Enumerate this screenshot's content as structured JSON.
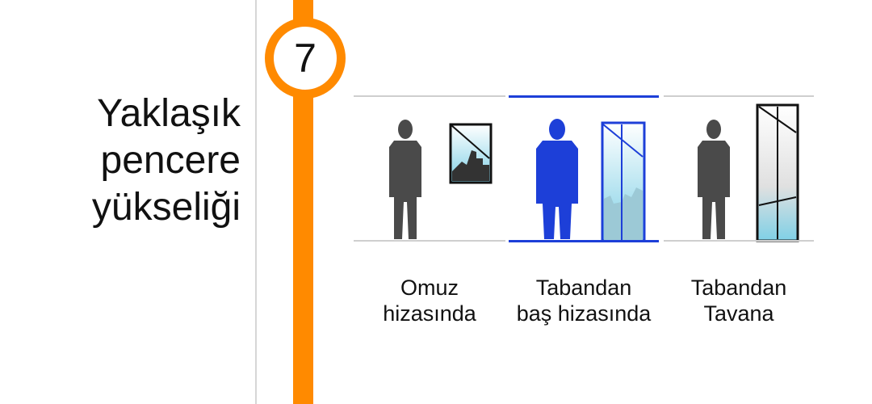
{
  "question": {
    "lines": [
      "Yaklaşık",
      "pencere",
      "yükseliği"
    ]
  },
  "step": {
    "number": "7"
  },
  "colors": {
    "accent": "#ff8a00",
    "selected": "#1d3fd8",
    "figure": "#4a4a4a"
  },
  "options": [
    {
      "lines": [
        "Omuz",
        "hizasında"
      ],
      "icon": "person-with-shoulder-height-window-icon",
      "selected": false
    },
    {
      "lines": [
        "Tabandan",
        "baş hizasında"
      ],
      "icon": "person-with-head-height-window-icon",
      "selected": true
    },
    {
      "lines": [
        "Tabandan",
        "Tavana"
      ],
      "icon": "person-with-floor-to-ceiling-window-icon",
      "selected": false
    }
  ]
}
